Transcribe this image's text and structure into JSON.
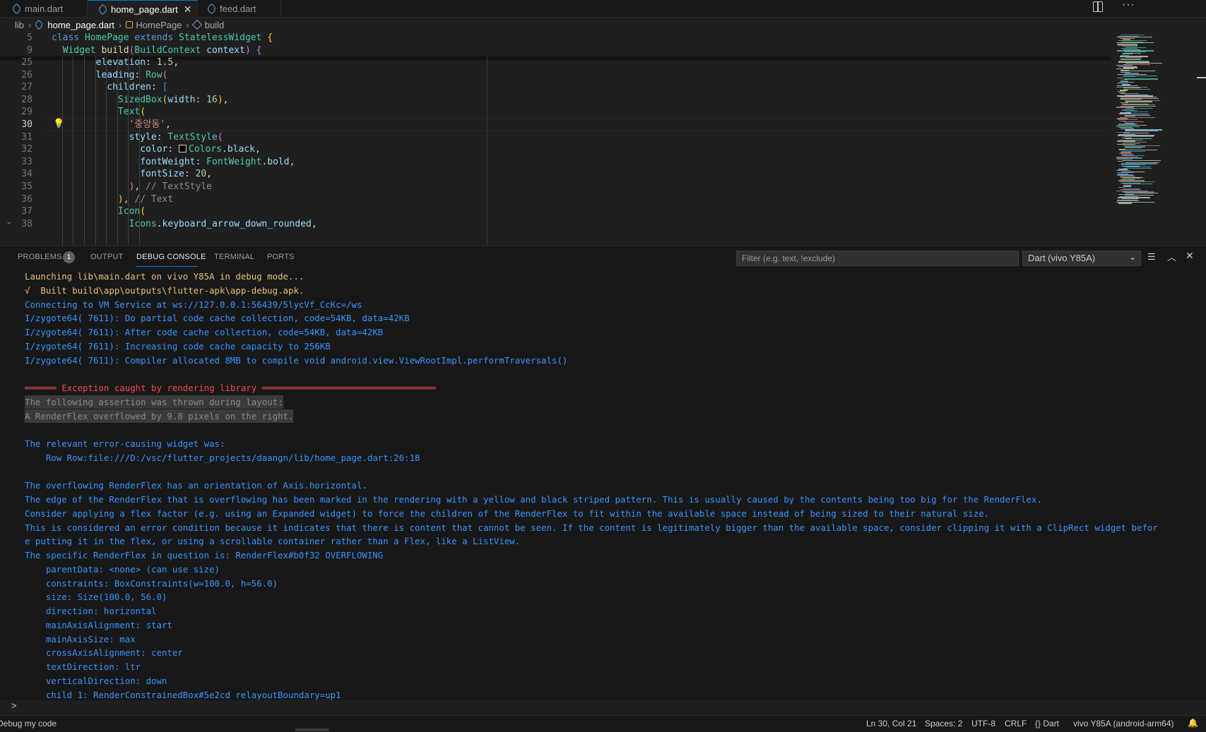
{
  "tabs": [
    {
      "label": "main.dart",
      "active": false
    },
    {
      "label": "home_page.dart",
      "active": true
    },
    {
      "label": "feed.dart",
      "active": false
    }
  ],
  "breadcrumb": {
    "folder": "lib",
    "file": "home_page.dart",
    "class": "HomePage",
    "method": "build"
  },
  "editor": {
    "sticky": [
      {
        "num": "5",
        "html": "<span class='k'>class</span> <span class='t'>HomePage</span> <span class='k'>extends</span> <span class='t'>StatelessWidget</span> <span class='br1'>{</span>"
      },
      {
        "num": "9",
        "html": "  <span class='t'>Widget</span> <span class='f'>build</span><span class='br2'>(</span><span class='t'>BuildContext</span> <span class='p'>context</span><span class='br2'>)</span> <span class='br2'>{</span>"
      }
    ],
    "lines": [
      {
        "num": "25",
        "html": "        <span class='p'>elevation</span><span class='pu'>:</span> <span class='n'>1.5</span><span class='pu'>,</span>"
      },
      {
        "num": "26",
        "html": "        <span class='p'>leading</span><span class='pu'>:</span> <span class='t'>Row</span><span class='br2'>(</span>"
      },
      {
        "num": "27",
        "html": "          <span class='p'>children</span><span class='pu'>:</span> <span class='br3'>[</span>"
      },
      {
        "num": "28",
        "html": "            <span class='t'>SizedBox</span><span class='br1'>(</span><span class='p'>width</span><span class='pu'>:</span> <span class='n'>16</span><span class='br1'>)</span><span class='pu'>,</span>"
      },
      {
        "num": "29",
        "html": "            <span class='t'>Text</span><span class='br1'>(</span>"
      },
      {
        "num": "30",
        "html": "              <span class='s'>'중앙동'</span><span class='pu'>,</span>",
        "current": true
      },
      {
        "num": "31",
        "html": "              <span class='p'>style</span><span class='pu'>:</span> <span class='t'>TextStyle</span><span class='br2'>(</span>"
      },
      {
        "num": "32",
        "html": "                <span class='p'>color</span><span class='pu'>:</span> <span class='swatch'></span><span class='t'>Colors</span><span class='pu'>.</span><span class='p'>black</span><span class='pu'>,</span>"
      },
      {
        "num": "33",
        "html": "                <span class='p'>fontWeight</span><span class='pu'>:</span> <span class='t'>FontWeight</span><span class='pu'>.</span><span class='p'>bold</span><span class='pu'>,</span>"
      },
      {
        "num": "34",
        "html": "                <span class='p'>fontSize</span><span class='pu'>:</span> <span class='n'>20</span><span class='pu'>,</span>"
      },
      {
        "num": "35",
        "html": "              <span class='br2'>)</span><span class='pu'>,</span> <span class='cm'>// TextStyle</span>"
      },
      {
        "num": "36",
        "html": "            <span class='br1'>)</span><span class='pu'>,</span> <span class='cm'>// Text</span>"
      },
      {
        "num": "37",
        "html": "            <span class='t'>Icon</span><span class='br1'>(</span>"
      },
      {
        "num": "38",
        "html": "              <span class='t'>Icons</span><span class='pu'>.</span><span class='p'>keyboard_arrow_down_rounded</span><span class='pu'>,</span>"
      }
    ]
  },
  "panel": {
    "tabs": [
      "PROBLEMS",
      "OUTPUT",
      "DEBUG CONSOLE",
      "TERMINAL",
      "PORTS"
    ],
    "problems_count": "1",
    "filter_placeholder": "Filter (e.g. text, !exclude)",
    "session": "Dart (vivo Y85A)",
    "console": [
      {
        "cls": "yel",
        "text": "Launching lib\\main.dart on vivo Y85A in debug mode..."
      },
      {
        "cls": "yel",
        "text": "√  Built build\\app\\outputs\\flutter-apk\\app-debug.apk."
      },
      {
        "cls": "blue",
        "text": "Connecting to VM Service at ws://127.0.0.1:56439/5lycVf_CcKc=/ws"
      },
      {
        "cls": "blue",
        "text": "I/zygote64( 7611): Do partial code cache collection, code=54KB, data=42KB"
      },
      {
        "cls": "blue",
        "text": "I/zygote64( 7611): After code cache collection, code=54KB, data=42KB"
      },
      {
        "cls": "blue",
        "text": "I/zygote64( 7611): Increasing code cache capacity to 256KB"
      },
      {
        "cls": "blue",
        "text": "I/zygote64( 7611): Compiler allocated 8MB to compile void android.view.ViewRootImpl.performTraversals()"
      },
      {
        "cls": "blue",
        "text": ""
      },
      {
        "cls": "red",
        "text": "══════ Exception caught by rendering library ═════════════════════════════════"
      },
      {
        "cls": "sel",
        "text": "The following assertion was thrown during layout:"
      },
      {
        "cls": "sel",
        "text": "A RenderFlex overflowed by 9.8 pixels on the right."
      },
      {
        "cls": "blue",
        "text": ""
      },
      {
        "cls": "blue",
        "text": "The relevant error-causing widget was:"
      },
      {
        "cls": "blue",
        "text": "    Row Row:file:///D:/vsc/flutter_projects/daangn/lib/home_page.dart:26:18"
      },
      {
        "cls": "blue",
        "text": ""
      },
      {
        "cls": "blue",
        "text": "The overflowing RenderFlex has an orientation of Axis.horizontal."
      },
      {
        "cls": "blue",
        "text": "The edge of the RenderFlex that is overflowing has been marked in the rendering with a yellow and black striped pattern. This is usually caused by the contents being too big for the RenderFlex."
      },
      {
        "cls": "blue",
        "text": "Consider applying a flex factor (e.g. using an Expanded widget) to force the children of the RenderFlex to fit within the available space instead of being sized to their natural size."
      },
      {
        "cls": "blue",
        "text": "This is considered an error condition because it indicates that there is content that cannot be seen. If the content is legitimately bigger than the available space, consider clipping it with a ClipRect widget befor"
      },
      {
        "cls": "blue",
        "text": "e putting it in the flex, or using a scrollable container rather than a Flex, like a ListView."
      },
      {
        "cls": "blue",
        "text": "The specific RenderFlex in question is: RenderFlex#b0f32 OVERFLOWING"
      },
      {
        "cls": "blue",
        "text": "    parentData: <none> (can use size)"
      },
      {
        "cls": "blue",
        "text": "    constraints: BoxConstraints(w=100.0, h=56.0)"
      },
      {
        "cls": "blue",
        "text": "    size: Size(100.0, 56.0)"
      },
      {
        "cls": "blue",
        "text": "    direction: horizontal"
      },
      {
        "cls": "blue",
        "text": "    mainAxisAlignment: start"
      },
      {
        "cls": "blue",
        "text": "    mainAxisSize: max"
      },
      {
        "cls": "blue",
        "text": "    crossAxisAlignment: center"
      },
      {
        "cls": "blue",
        "text": "    textDirection: ltr"
      },
      {
        "cls": "blue",
        "text": "    verticalDirection: down"
      },
      {
        "cls": "blue",
        "text": "    child 1: RenderConstrainedBox#5e2cd relayoutBoundary=up1"
      }
    ],
    "prompt": ">"
  },
  "statusbar": {
    "left": "Debug my code",
    "position": "Ln 30, Col 21",
    "spaces": "Spaces: 2",
    "encoding": "UTF-8",
    "eol": "CRLF",
    "language": "{} Dart",
    "device": "vivo Y85A (android-arm64)"
  }
}
